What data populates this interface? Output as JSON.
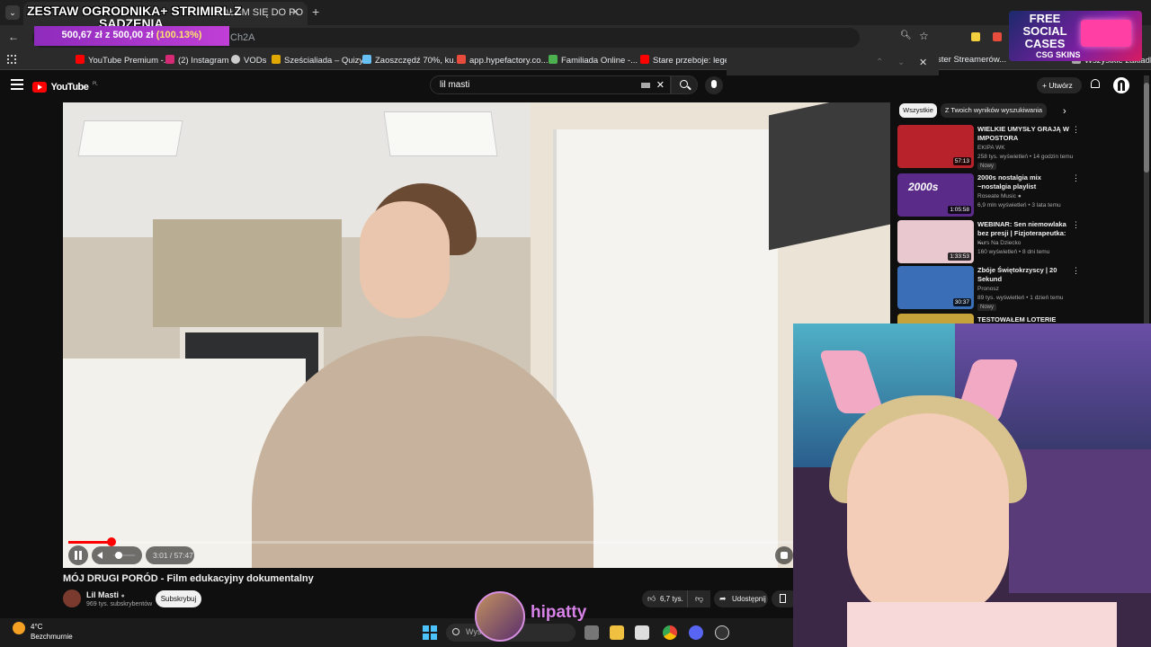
{
  "browser": {
    "active_tab_title": "ZAPISAŁEM SIĘ DO PO",
    "url_fragment": "Ch2A",
    "bookmarks": [
      {
        "label": "YouTube Premium -...",
        "color": "#ff0000"
      },
      {
        "label": "(2) Instagram",
        "color": "#d62976"
      },
      {
        "label": "VODs",
        "color": "#cccccc"
      },
      {
        "label": "Sześcialiada – Quizy...",
        "color": "#e0a800"
      },
      {
        "label": "Zaoszczędź 70%, ku...",
        "color": "#66c0f4"
      },
      {
        "label": "app.hypefactory.co...",
        "color": "#e74c3c"
      },
      {
        "label": "Familiada Online -...",
        "color": "#4caf50"
      },
      {
        "label": "Stare przeboje: lege...",
        "color": "#ff0000"
      }
    ],
    "bookmark_extra_1": "ster Streamerów...",
    "bookmark_extra_2": "Wszystkie zakładki"
  },
  "donation": {
    "title_line1": "ZESTAW OGRODNIKA+ STRIMIRL Z",
    "title_line2": "SADZENIA",
    "current": "500,67 zł",
    "separator": "z",
    "goal": "500,00 zł",
    "percent": "(100.13%)"
  },
  "sponsor": {
    "line1": "FREE",
    "line2": "SOCIAL",
    "line3": "CASES",
    "footer": "CSG SKINS"
  },
  "youtube": {
    "logo_text": "YouTube",
    "country": "PL",
    "search_query": "lil masti",
    "create_label": "Utwórz"
  },
  "player": {
    "progress_fraction": 0.059,
    "time_current": "3:01",
    "time_total": "57:47"
  },
  "video": {
    "title": "MÓJ DRUGI PORÓD - Film edukacyjny dokumentalny",
    "channel": "Lil Masti",
    "subscribers": "969 tys. subskrybentów",
    "subscribe_label": "Subskrybuj",
    "likes": "6,7 tys.",
    "share_label": "Udostępnij"
  },
  "sidebar": {
    "chips": [
      "Wszystkie",
      "Z Twoich wyników wyszukiwania"
    ],
    "recommendations": [
      {
        "title": "WIELKIE UMYSŁY GRAJĄ W IMPOSTORA",
        "channel": "EKIPA WK",
        "meta": "258 tys. wyświetleń • 14 godzin temu",
        "badge": "Nowy",
        "duration": "57:13",
        "thumb": "#b8232b"
      },
      {
        "title": "2000s nostalgia mix ~nostalgia playlist",
        "channel": "Roseate Music",
        "meta": "6,9 mln wyświetleń • 3 lata temu",
        "badge": "",
        "duration": "1:05:58",
        "thumb": "#5b2b8a"
      },
      {
        "title": "WEBINAR: Sen niemowlaka bez presji | Fizjoterapeutka: ...",
        "channel": "Kurs Na Dziecko",
        "meta": "160 wyświetleń • 8 dni temu",
        "badge": "",
        "duration": "1:33:53",
        "thumb": "#e9c9cf"
      },
      {
        "title": "Zbóje Świętokrzyscy | 20 Sekund",
        "channel": "Pronosz",
        "meta": "89 tys. wyświetleń • 1 dzień temu",
        "badge": "Nowy",
        "duration": "30:37",
        "thumb": "#3a6fb8"
      },
      {
        "title": "TESTOWAŁEM LOTERIE PRZEZ",
        "channel": "",
        "meta": "",
        "badge": "",
        "duration": "",
        "thumb": "#c6a23a"
      }
    ]
  },
  "stream": {
    "streamer": "hipatty"
  },
  "taskbar": {
    "temperature": "4°C",
    "condition": "Bezchmurnie",
    "search_placeholder": "Wyszukaj"
  }
}
